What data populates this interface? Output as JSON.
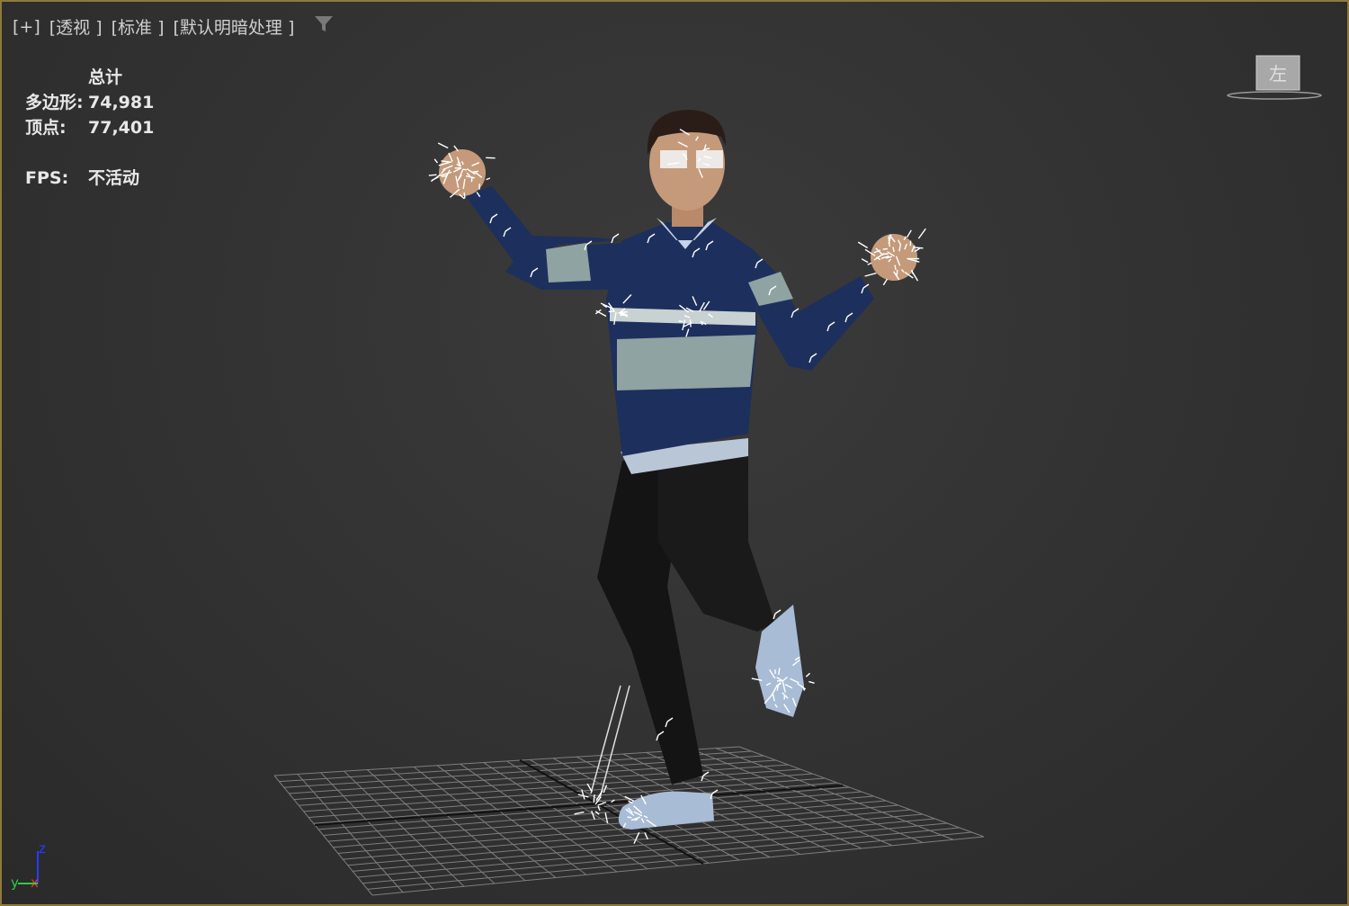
{
  "viewport": {
    "labels": [
      "[+]",
      "[透视 ]",
      "[标准 ]",
      "[默认明暗处理 ]"
    ],
    "filter_icon": "filter-icon"
  },
  "stats": {
    "header": "总计",
    "polygons_label": "多边形:",
    "polygons_value": "74,981",
    "vertices_label": "顶点:",
    "vertices_value": "77,401",
    "fps_label": "FPS:",
    "fps_value": "不活动"
  },
  "viewcube": {
    "label": "左"
  },
  "axis_gizmo": {
    "z": "z",
    "y": "y",
    "x": "x"
  },
  "colors": {
    "border": "#8f7a3c",
    "sweater_navy": "#1d2f5c",
    "sweater_stripe": "#8ea3a2",
    "pants": "#151515",
    "shoes": "#a9bcd6",
    "skin": "#c49a7a",
    "grid": "#9a9a9a",
    "axis_z": "#2a3cff",
    "axis_y": "#2ecc40",
    "axis_x": "#ff3030"
  }
}
